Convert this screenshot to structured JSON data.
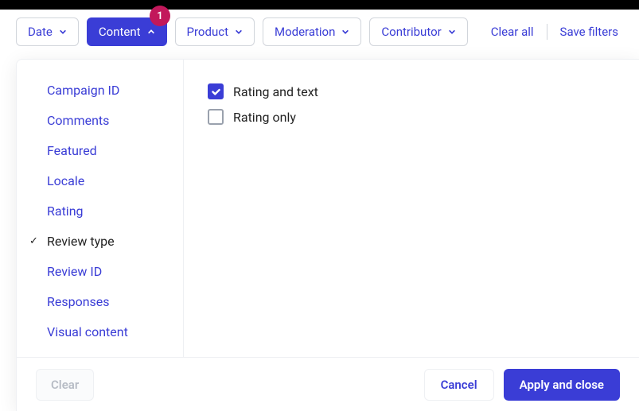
{
  "badge": {
    "count": "1"
  },
  "filters": {
    "date": "Date",
    "content": "Content",
    "product": "Product",
    "moderation": "Moderation",
    "contributor": "Contributor"
  },
  "actions": {
    "clear_all": "Clear all",
    "save_filters": "Save filters"
  },
  "sidebar": {
    "items": [
      {
        "label": "Campaign ID",
        "selected": false
      },
      {
        "label": "Comments",
        "selected": false
      },
      {
        "label": "Featured",
        "selected": false
      },
      {
        "label": "Locale",
        "selected": false
      },
      {
        "label": "Rating",
        "selected": false
      },
      {
        "label": "Review type",
        "selected": true
      },
      {
        "label": "Review ID",
        "selected": false
      },
      {
        "label": "Responses",
        "selected": false
      },
      {
        "label": "Visual content",
        "selected": false
      }
    ]
  },
  "options": [
    {
      "label": "Rating and text",
      "checked": true
    },
    {
      "label": "Rating only",
      "checked": false
    }
  ],
  "footer": {
    "clear": "Clear",
    "cancel": "Cancel",
    "apply": "Apply and close"
  }
}
